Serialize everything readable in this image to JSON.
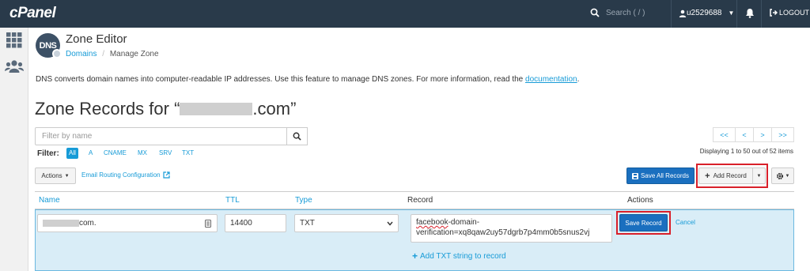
{
  "topbar": {
    "logo": "cPanel",
    "search_placeholder": "Search ( / )",
    "username": "u2529688",
    "logout_label": "LOGOUT"
  },
  "header": {
    "badge": "DNS",
    "title": "Zone Editor",
    "breadcrumb_link": "Domains",
    "breadcrumb_sep": "/",
    "breadcrumb_current": "Manage Zone"
  },
  "intro": {
    "text": "DNS converts domain names into computer-readable IP addresses. Use this feature to manage DNS zones. For more information, read the ",
    "link": "documentation",
    "end": "."
  },
  "records": {
    "title_prefix": "Zone Records for “",
    "title_suffix": ".com”"
  },
  "filter": {
    "placeholder": "Filter by name",
    "label": "Filter:",
    "chips": [
      "All",
      "A",
      "CNAME",
      "MX",
      "SRV",
      "TXT"
    ],
    "active": "All"
  },
  "pagination": {
    "first": "<<",
    "prev": "<",
    "next": ">",
    "last": ">>",
    "displaying": "Displaying 1 to 50 out of 52 items"
  },
  "toolbar": {
    "actions": "Actions",
    "email_routing": "Email Routing Configuration",
    "save_all": "Save All Records",
    "add_record": "Add Record"
  },
  "table": {
    "headers": [
      "Name",
      "TTL",
      "Type",
      "Record",
      "Actions"
    ],
    "row": {
      "name_suffix": "com.",
      "ttl": "14400",
      "type": "TXT",
      "record_line1": "facebook",
      "record_line1_rest": "-domain-",
      "record_line2": "verification=xq8qaw2uy57dgrb7p4mm0b5snus2vj",
      "add_string": "Add TXT string to record",
      "save": "Save Record",
      "cancel": "Cancel"
    }
  },
  "colors": {
    "topbar": "#293a4a",
    "link": "#179bd7",
    "primary": "#1a6fbf",
    "highlight": "#d9202a",
    "row_bg": "#d9edf7"
  }
}
